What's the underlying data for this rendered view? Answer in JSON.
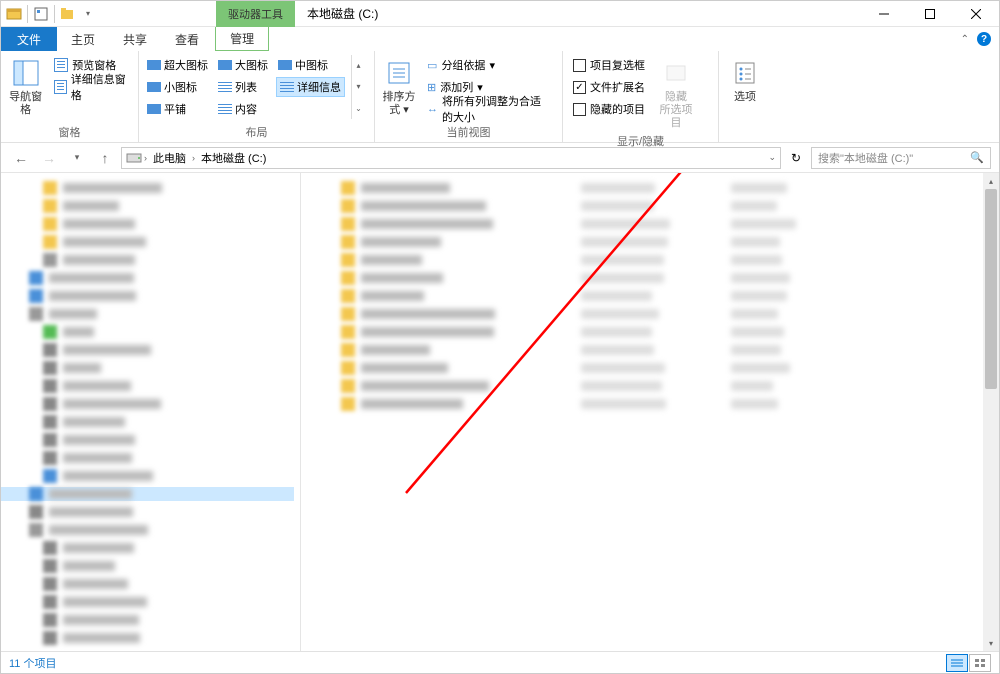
{
  "title": "本地磁盘 (C:)",
  "contextual_tab": "驱动器工具",
  "tabs": {
    "file": "文件",
    "home": "主页",
    "share": "共享",
    "view": "查看",
    "manage": "管理"
  },
  "ribbon": {
    "panes": {
      "nav_pane": "导航窗格",
      "preview_pane": "预览窗格",
      "details_pane": "详细信息窗格",
      "label": "窗格"
    },
    "layout": {
      "extra_large": "超大图标",
      "large": "大图标",
      "medium": "中图标",
      "small": "小图标",
      "list": "列表",
      "details": "详细信息",
      "tiles": "平铺",
      "content": "内容",
      "label": "布局"
    },
    "current_view": {
      "sort_by": "排序方式",
      "group_by": "分组依据",
      "add_columns": "添加列",
      "size_all": "将所有列调整为合适的大小",
      "label": "当前视图"
    },
    "show_hide": {
      "item_checkboxes": "项目复选框",
      "file_ext": "文件扩展名",
      "hidden_items": "隐藏的项目",
      "hide_selected": "隐藏",
      "hide_selected2": "所选项目",
      "label": "显示/隐藏"
    },
    "options": "选项"
  },
  "breadcrumb": {
    "this_pc": "此电脑",
    "drive": "本地磁盘 (C:)"
  },
  "search_placeholder": "搜索\"本地磁盘 (C:)\"",
  "status": "11 个项目"
}
